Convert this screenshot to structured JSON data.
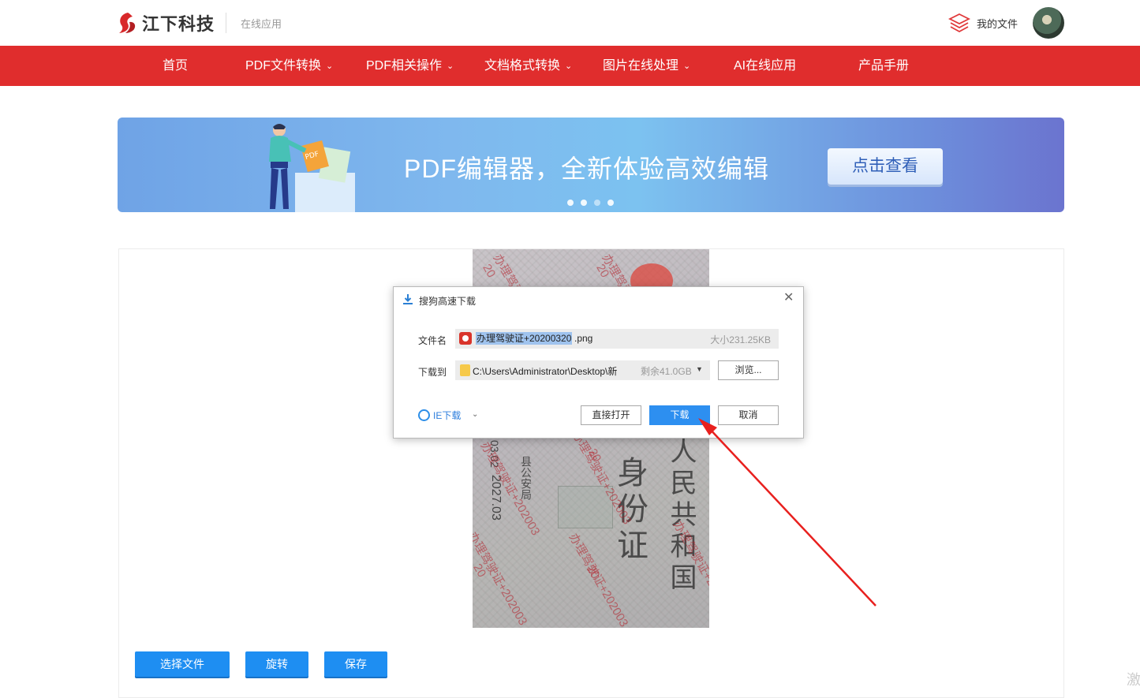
{
  "header": {
    "brand": "江下科技",
    "subtitle": "在线应用",
    "my_files": "我的文件"
  },
  "nav": {
    "items": [
      {
        "label": "首页",
        "has_dropdown": false
      },
      {
        "label": "PDF文件转换",
        "has_dropdown": true
      },
      {
        "label": "PDF相关操作",
        "has_dropdown": true
      },
      {
        "label": "文档格式转换",
        "has_dropdown": true
      },
      {
        "label": "图片在线处理",
        "has_dropdown": true
      },
      {
        "label": "AI在线应用",
        "has_dropdown": false
      },
      {
        "label": "产品手册",
        "has_dropdown": false
      }
    ]
  },
  "banner": {
    "headline": "PDF编辑器，全新体验高效编辑",
    "cta": "点击查看",
    "slides_total": 4,
    "active_slide": 1
  },
  "preview": {
    "watermarks": [
      "办理驾驶证+2020",
      "20",
      "办理驾驶证+2020",
      "20",
      "办理驾驶证+202003",
      "20",
      "办理驾驶证+202003",
      "20",
      "办理驾驶证+202003",
      "20"
    ],
    "card_text": [
      "人民共和国",
      "身份证"
    ],
    "date_text": "2027.03",
    "date_prefix": "03.02",
    "authority": "县公安局"
  },
  "actions": {
    "choose_file": "选择文件",
    "rotate": "旋转",
    "save": "保存"
  },
  "dialog": {
    "title": "搜狗高速下载",
    "filename_label": "文件名",
    "filename_selected": "办理驾驶证+20200320",
    "filename_ext": ".png",
    "filesize": "大小231.25KB",
    "saveto_label": "下载到",
    "path": "C:\\Users\\Administrator\\Desktop\\新",
    "free_space": "剩余41.0GB",
    "browse": "浏览...",
    "ie_download": "IE下载",
    "open_directly": "直接打开",
    "download": "下载",
    "cancel": "取消"
  },
  "colors": {
    "nav_red": "#e02d2d",
    "primary_blue": "#1e8ef2",
    "arrow_red": "#e8201e"
  },
  "corner_char": "激"
}
